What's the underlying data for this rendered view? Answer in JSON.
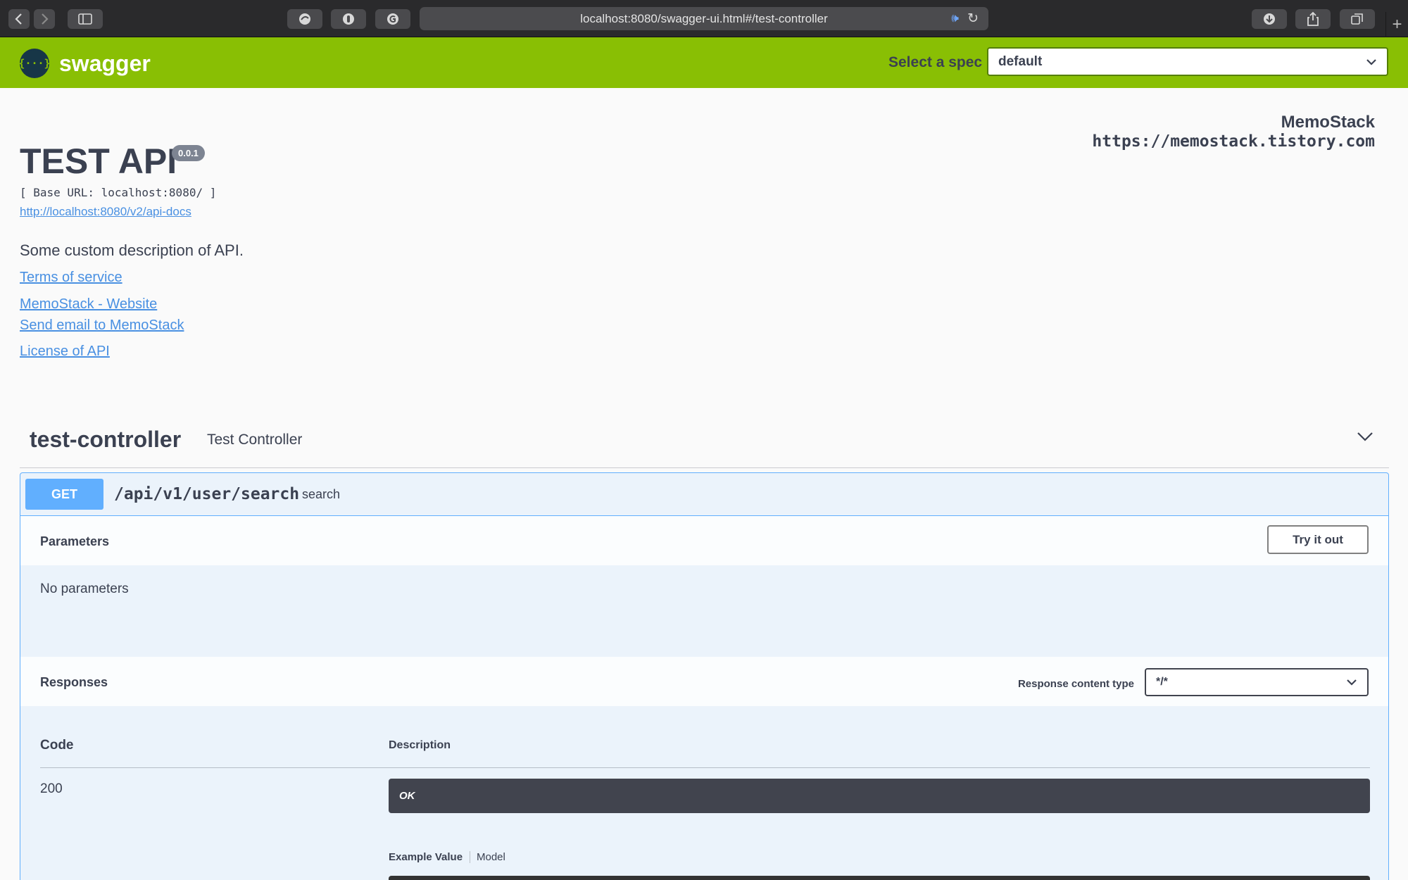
{
  "browser": {
    "url": "localhost:8080/swagger-ui.html#/test-controller"
  },
  "topbar": {
    "logo_text": "swagger",
    "logo_glyph": "{···}",
    "spec_label": "Select a spec",
    "spec_value": "default",
    "brand_color": "#89bf04"
  },
  "info": {
    "title": "TEST API",
    "version": "0.0.1",
    "base_url": "[ Base URL: localhost:8080/ ]",
    "docs_link": "http://localhost:8080/v2/api-docs",
    "description": "Some custom description of API.",
    "contact_name": "MemoStack",
    "contact_url": "https://memostack.tistory.com",
    "links": {
      "terms": "Terms of service",
      "website": "MemoStack - Website",
      "email": "Send email to MemoStack",
      "license": "License of API"
    }
  },
  "tag": {
    "name": "test-controller",
    "description": "Test Controller"
  },
  "operation": {
    "method": "GET",
    "method_color": "#61affe",
    "path": "/api/v1/user/search",
    "summary": "search",
    "parameters_title": "Parameters",
    "try_it_out": "Try it out",
    "no_parameters": "No parameters",
    "responses_title": "Responses",
    "response_content_type_label": "Response content type",
    "response_content_type": "*/*",
    "columns": {
      "code": "Code",
      "description": "Description"
    },
    "responses": [
      {
        "code": "200",
        "description": "OK"
      }
    ],
    "tabs": {
      "example": "Example Value",
      "model": "Model"
    }
  }
}
